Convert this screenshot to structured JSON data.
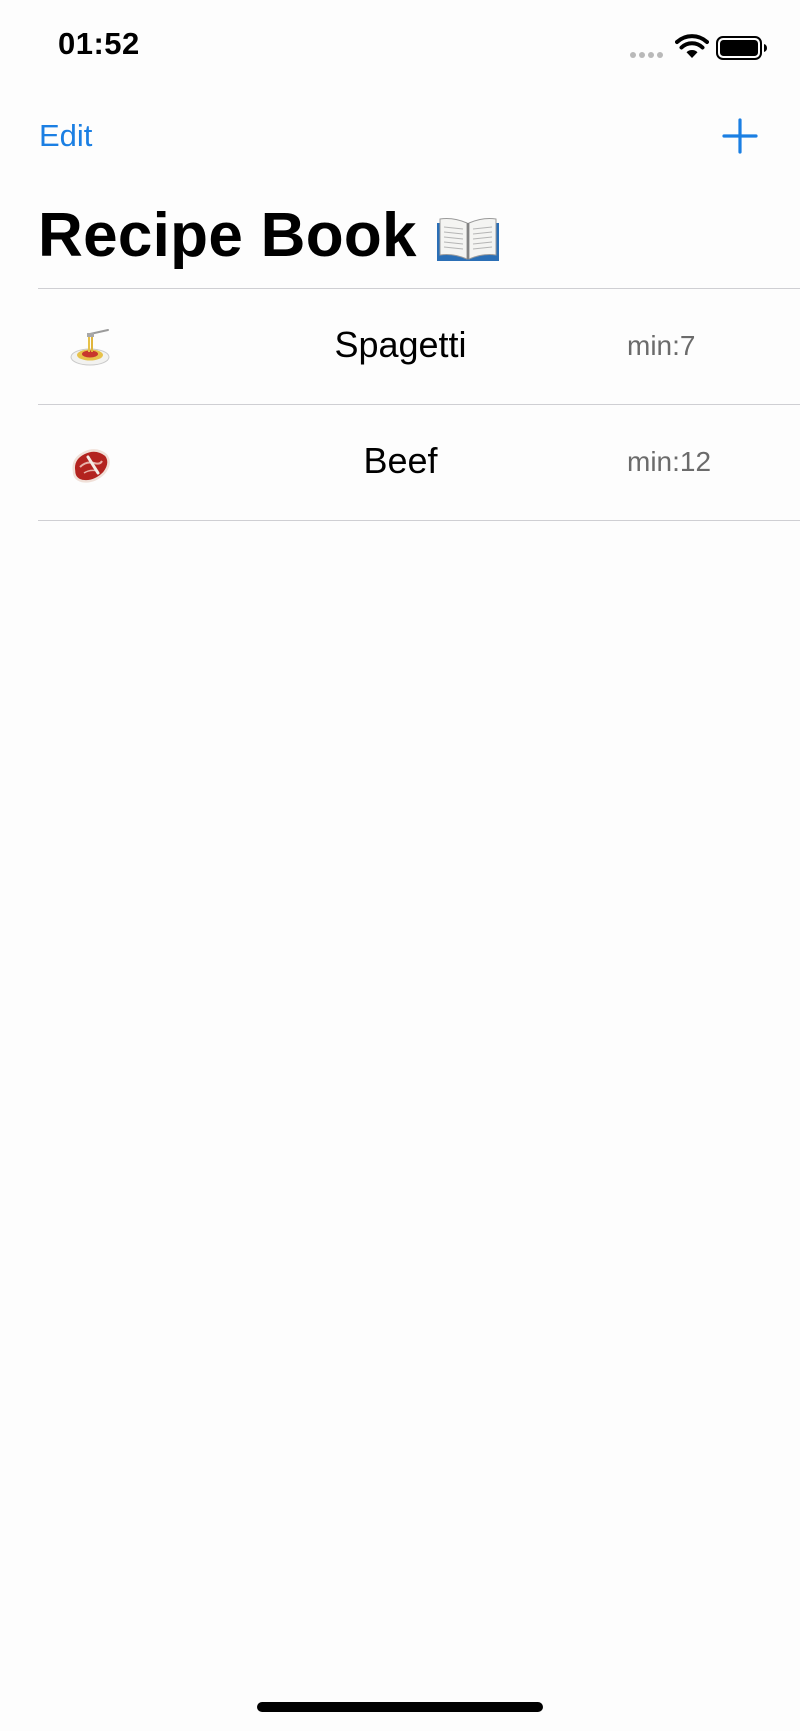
{
  "status_bar": {
    "time": "01:52",
    "icons": [
      "cellular-signal-icon",
      "wifi-icon",
      "battery-icon"
    ]
  },
  "nav": {
    "edit_label": "Edit",
    "add_icon": "plus-icon",
    "accent_color": "#1b7fe3"
  },
  "title": {
    "text": "Recipe Book",
    "icon": "open-book-icon"
  },
  "recipes": [
    {
      "icon": "spaghetti-icon",
      "name": "Spagetti",
      "time": "min:7"
    },
    {
      "icon": "steak-icon",
      "name": "Beef",
      "time": "min:12"
    }
  ]
}
